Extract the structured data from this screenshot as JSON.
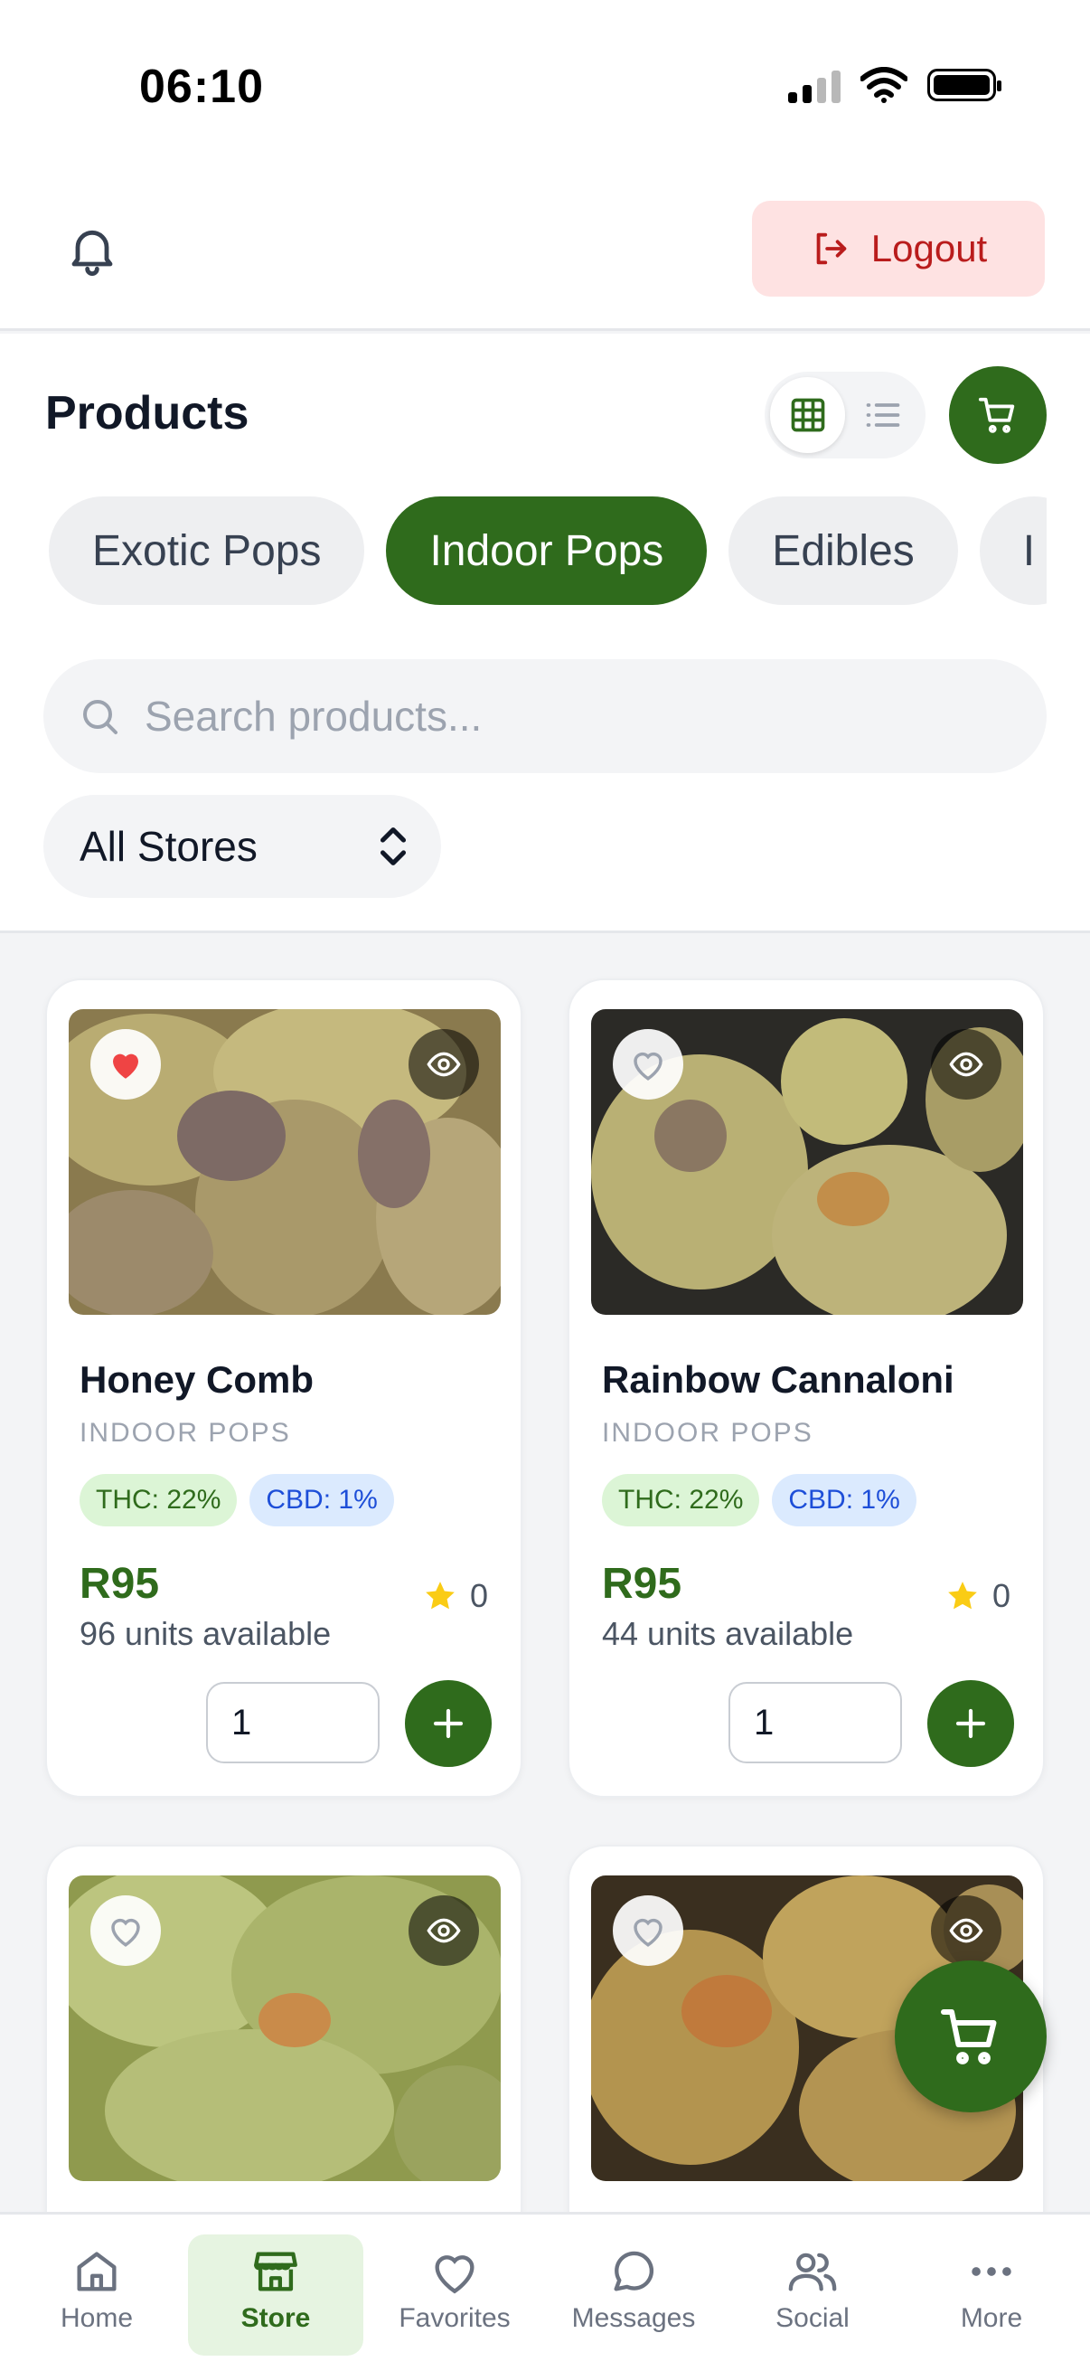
{
  "status_bar": {
    "time": "06:10"
  },
  "topbar": {
    "logout_label": "Logout"
  },
  "header": {
    "title": "Products"
  },
  "categories": [
    {
      "label": "Exotic Pops",
      "active": false
    },
    {
      "label": "Indoor Pops",
      "active": true
    },
    {
      "label": "Edibles",
      "active": false
    },
    {
      "label": "I",
      "active": false
    }
  ],
  "search": {
    "placeholder": "Search products..."
  },
  "store_filter": {
    "selected": "All Stores"
  },
  "products": [
    {
      "name": "Honey Comb",
      "category": "INDOOR POPS",
      "thc": "THC: 22%",
      "cbd": "CBD: 1%",
      "price": "R95",
      "units": "96 units available",
      "rating": "0",
      "qty": "1",
      "favorited": true
    },
    {
      "name": "Rainbow Cannaloni",
      "category": "INDOOR POPS",
      "thc": "THC: 22%",
      "cbd": "CBD: 1%",
      "price": "R95",
      "units": "44 units available",
      "rating": "0",
      "qty": "1",
      "favorited": false
    },
    {
      "favorited": false
    },
    {
      "favorited": false
    }
  ],
  "bottom_nav": [
    {
      "label": "Home",
      "icon": "home-icon"
    },
    {
      "label": "Store",
      "icon": "store-icon",
      "active": true
    },
    {
      "label": "Favorites",
      "icon": "heart-icon"
    },
    {
      "label": "Messages",
      "icon": "message-icon"
    },
    {
      "label": "Social",
      "icon": "users-icon"
    },
    {
      "label": "More",
      "icon": "more-icon"
    }
  ],
  "colors": {
    "brand": "#2f6b1c",
    "logout": "#b91c1c",
    "favorite": "#ef4444",
    "star": "#facc15"
  }
}
